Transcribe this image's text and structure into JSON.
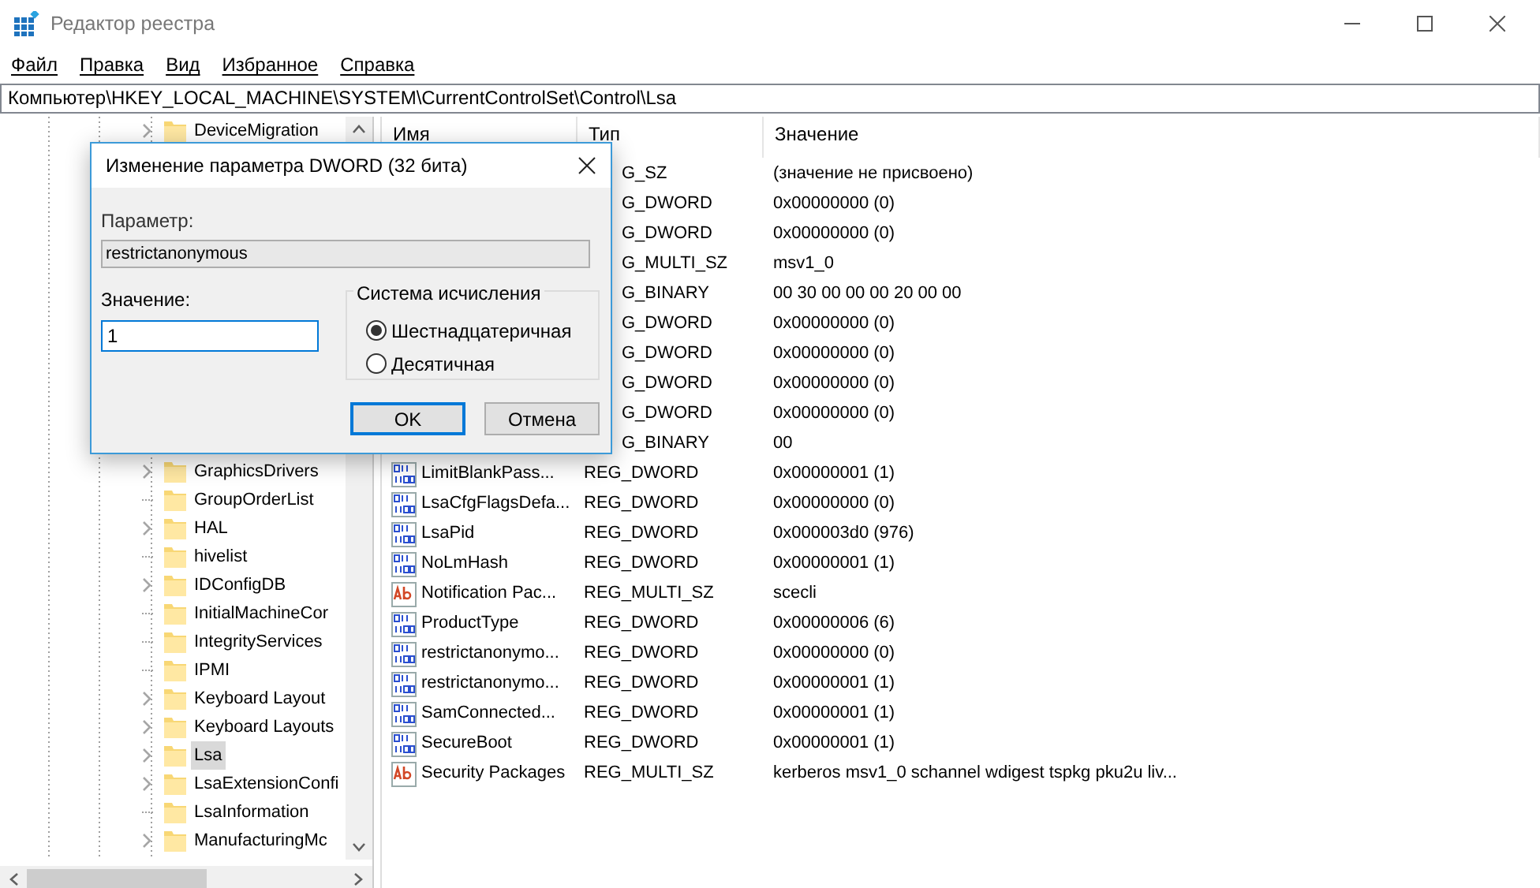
{
  "window": {
    "title": "Редактор реестра"
  },
  "menu": [
    "Файл",
    "Правка",
    "Вид",
    "Избранное",
    "Справка"
  ],
  "address": "Компьютер\\HKEY_LOCAL_MACHINE\\SYSTEM\\CurrentControlSet\\Control\\Lsa",
  "tree": {
    "items": [
      {
        "label": "DeviceMigration",
        "expandable": true,
        "selected": false
      },
      {
        "label": "GraphicsDrivers",
        "expandable": true,
        "selected": false
      },
      {
        "label": "GroupOrderList",
        "expandable": false,
        "selected": false
      },
      {
        "label": "HAL",
        "expandable": true,
        "selected": false
      },
      {
        "label": "hivelist",
        "expandable": false,
        "selected": false
      },
      {
        "label": "IDConfigDB",
        "expandable": true,
        "selected": false
      },
      {
        "label": "InitialMachineCor",
        "expandable": false,
        "selected": false
      },
      {
        "label": "IntegrityServices",
        "expandable": false,
        "selected": false
      },
      {
        "label": "IPMI",
        "expandable": false,
        "selected": false
      },
      {
        "label": "Keyboard Layout",
        "expandable": true,
        "selected": false
      },
      {
        "label": "Keyboard Layouts",
        "expandable": true,
        "selected": false
      },
      {
        "label": "Lsa",
        "expandable": true,
        "selected": true
      },
      {
        "label": "LsaExtensionConfi",
        "expandable": true,
        "selected": false
      },
      {
        "label": "LsaInformation",
        "expandable": false,
        "selected": false
      },
      {
        "label": "ManufacturingMc",
        "expandable": true,
        "selected": false
      }
    ]
  },
  "table": {
    "columns": [
      "Имя",
      "Тип",
      "Значение"
    ],
    "rows": [
      {
        "kind": "covered",
        "type": "G_SZ",
        "value": "(значение не присвоено)"
      },
      {
        "kind": "covered",
        "type": "G_DWORD",
        "value": "0x00000000 (0)"
      },
      {
        "kind": "covered",
        "type": "G_DWORD",
        "value": "0x00000000 (0)"
      },
      {
        "kind": "covered",
        "type": "G_MULTI_SZ",
        "value": "msv1_0"
      },
      {
        "kind": "covered",
        "type": "G_BINARY",
        "value": "00 30 00 00 00 20 00 00"
      },
      {
        "kind": "covered",
        "type": "G_DWORD",
        "value": "0x00000000 (0)"
      },
      {
        "kind": "covered",
        "type": "G_DWORD",
        "value": "0x00000000 (0)"
      },
      {
        "kind": "covered",
        "type": "G_DWORD",
        "value": "0x00000000 (0)"
      },
      {
        "kind": "covered",
        "type": "G_DWORD",
        "value": "0x00000000 (0)"
      },
      {
        "kind": "covered",
        "type": "G_BINARY",
        "value": "00"
      },
      {
        "kind": "binary",
        "name": "LimitBlankPass...",
        "type": "REG_DWORD",
        "value": "0x00000001 (1)"
      },
      {
        "kind": "binary",
        "name": "LsaCfgFlagsDefa...",
        "type": "REG_DWORD",
        "value": "0x00000000 (0)"
      },
      {
        "kind": "binary",
        "name": "LsaPid",
        "type": "REG_DWORD",
        "value": "0x000003d0 (976)"
      },
      {
        "kind": "binary",
        "name": "NoLmHash",
        "type": "REG_DWORD",
        "value": "0x00000001 (1)"
      },
      {
        "kind": "string",
        "name": "Notification Pac...",
        "type": "REG_MULTI_SZ",
        "value": "scecli"
      },
      {
        "kind": "binary",
        "name": "ProductType",
        "type": "REG_DWORD",
        "value": "0x00000006 (6)"
      },
      {
        "kind": "binary",
        "name": "restrictanonymo...",
        "type": "REG_DWORD",
        "value": "0x00000000 (0)"
      },
      {
        "kind": "binary",
        "name": "restrictanonymo...",
        "type": "REG_DWORD",
        "value": "0x00000001 (1)"
      },
      {
        "kind": "binary",
        "name": "SamConnected...",
        "type": "REG_DWORD",
        "value": "0x00000001 (1)"
      },
      {
        "kind": "binary",
        "name": "SecureBoot",
        "type": "REG_DWORD",
        "value": "0x00000001 (1)"
      },
      {
        "kind": "string",
        "name": "Security Packages",
        "type": "REG_MULTI_SZ",
        "value": "kerberos msv1_0 schannel wdigest tspkg pku2u liv..."
      }
    ]
  },
  "dialog": {
    "title": "Изменение параметра DWORD (32 бита)",
    "name_label": "Параметр:",
    "name_value": "restrictanonymous",
    "value_label": "Значение:",
    "value": "1",
    "base_group": "Система исчисления",
    "bases": [
      {
        "label": "Шестнадцатеричная",
        "selected": true
      },
      {
        "label": "Десятичная",
        "selected": false
      }
    ],
    "buttons": [
      "OK",
      "Отмена"
    ]
  }
}
